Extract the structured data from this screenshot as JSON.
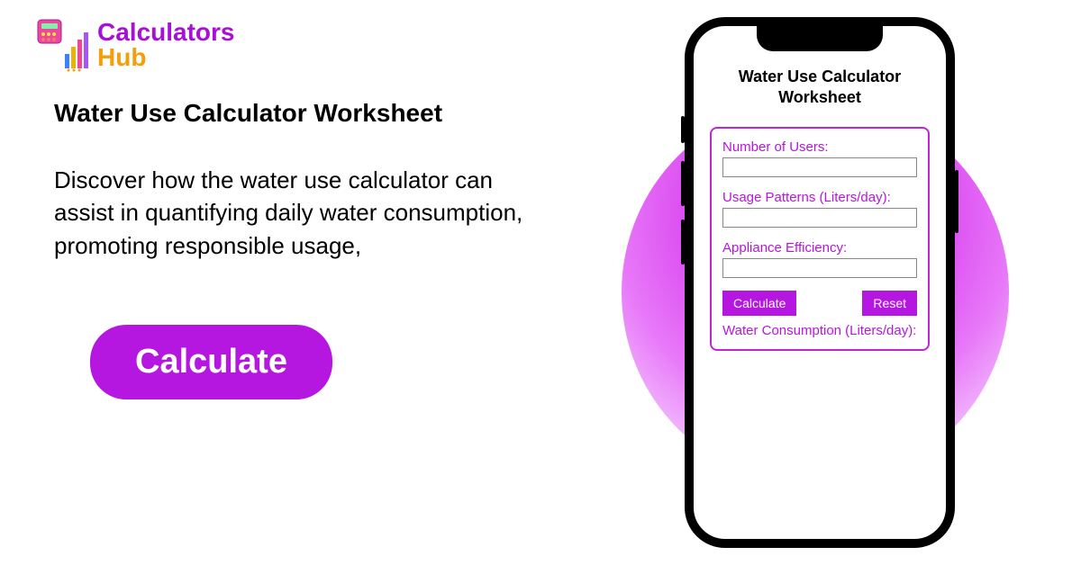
{
  "logo": {
    "line1": "Calculators",
    "line2": "Hub"
  },
  "heading": "Water Use Calculator Worksheet",
  "description": "Discover how the water use calculator can assist in quantifying daily water consumption, promoting responsible usage,",
  "cta": "Calculate",
  "phone": {
    "title": "Water Use Calculator Worksheet",
    "fields": {
      "users_label": "Number of Users:",
      "patterns_label": "Usage Patterns (Liters/day):",
      "efficiency_label": "Appliance Efficiency:"
    },
    "buttons": {
      "calculate": "Calculate",
      "reset": "Reset"
    },
    "result_label": "Water Consumption (Liters/day):"
  },
  "colors": {
    "brand_purple": "#b516e0",
    "brand_orange": "#f59e0b"
  }
}
